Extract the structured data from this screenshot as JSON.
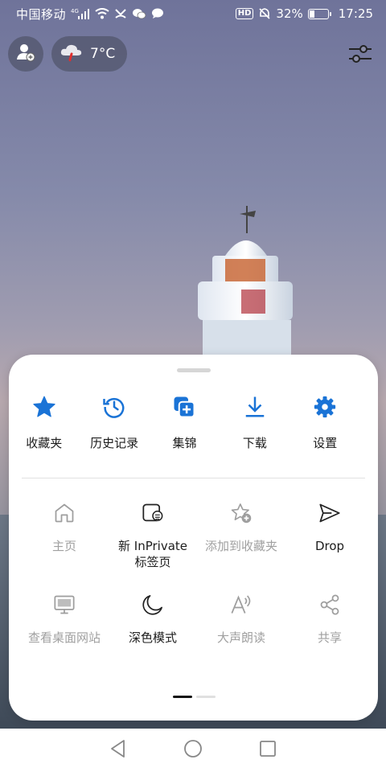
{
  "status": {
    "carrier": "中国移动",
    "network": "4G",
    "hd": "HD",
    "battery": "32%",
    "battery_level": 0.32,
    "time": "17:25"
  },
  "weather": {
    "temperature": "7°C",
    "icon": "cloud-rain-icon"
  },
  "quick_actions": [
    {
      "label": "收藏夹",
      "icon": "star-icon"
    },
    {
      "label": "历史记录",
      "icon": "history-icon"
    },
    {
      "label": "集锦",
      "icon": "collections-icon"
    },
    {
      "label": "下载",
      "icon": "download-icon"
    },
    {
      "label": "设置",
      "icon": "gear-icon"
    }
  ],
  "menu_rows": [
    [
      {
        "label": "主页",
        "icon": "home-icon",
        "enabled": false
      },
      {
        "label": "新 InPrivate\n标签页",
        "line1": "新 InPrivate",
        "line2": "标签页",
        "icon": "inprivate-tab-icon",
        "enabled": true
      },
      {
        "label": "添加到收藏夹",
        "icon": "star-add-icon",
        "enabled": false
      },
      {
        "label": "Drop",
        "icon": "send-icon",
        "enabled": true
      }
    ],
    [
      {
        "label": "查看桌面网站",
        "icon": "desktop-icon",
        "enabled": false
      },
      {
        "label": "深色模式",
        "icon": "moon-icon",
        "enabled": true
      },
      {
        "label": "大声朗读",
        "icon": "read-aloud-icon",
        "enabled": false
      },
      {
        "label": "共享",
        "icon": "share-icon",
        "enabled": false
      }
    ]
  ],
  "pagination": {
    "pages": 2,
    "current": 1
  },
  "colors": {
    "accent": "#1a73d6",
    "disabled": "#a0a0a0",
    "text": "#1d1d1d"
  }
}
